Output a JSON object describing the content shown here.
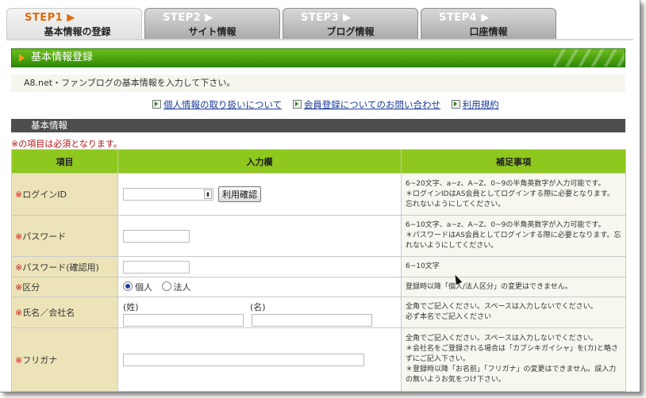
{
  "tabs": [
    {
      "step": "STEP1",
      "name": "基本情報の登録",
      "active": true
    },
    {
      "step": "STEP2",
      "name": "サイト情報",
      "active": false
    },
    {
      "step": "STEP3",
      "name": "ブログ情報",
      "active": false
    },
    {
      "step": "STEP4",
      "name": "口座情報",
      "active": false
    }
  ],
  "page_title": "基本情報登録",
  "intro": "A8.net・ファンブログの基本情報を入力して下さい。",
  "links": [
    "個人情報の取り扱いについて",
    "会員登録についてのお問い合わせ",
    "利用規約"
  ],
  "section_title": "基本情報",
  "required_note": "※の項目は必須となります。",
  "table": {
    "headers": [
      "項目",
      "入力欄",
      "補足事項"
    ],
    "rows": [
      {
        "label": "ログインID",
        "button": "利用確認",
        "note": "6~20文字、a~z、A~Z、0~9の半角英数字が入力可能です。\n＊ログインIDはAS会員としてログインする際に必要となります。忘れないようにしてください。"
      },
      {
        "label": "パスワード",
        "note": "6~10文字、a~z、A~Z、0~9の半角英数字が入力可能です。\n＊パスワードはAS会員としてログインする際に必要となります。忘れないようにしてください。"
      },
      {
        "label": "パスワード(確認用)",
        "note": "6~10文字"
      },
      {
        "label": "区分",
        "options": [
          "個人",
          "法人"
        ],
        "selected": "個人",
        "note": "登録時以降「個人/法人区分」の変更はできません。"
      },
      {
        "label": "氏名／会社名",
        "sub_labels": [
          "(姓)",
          "(名)"
        ],
        "note": "全角でご記入ください。スペースは入力しないでください。\n必ず本名でご記入ください"
      },
      {
        "label": "フリガナ",
        "note": "全角でご記入ください。スペースは入力しないでください。\n＊会社名をご登録される場合は「カブシキガイシャ」を(カ)と略さずにご記入下さい。\n＊登録時以降「お名前」「フリガナ」の変更はできません。誤入力の無いようお気をつけ下さい。"
      }
    ]
  },
  "colors": {
    "accent_green": "#3f9a0a",
    "header_green": "#8ec71e",
    "label_bg": "#ece4b8",
    "active_step": "#e06a00"
  }
}
